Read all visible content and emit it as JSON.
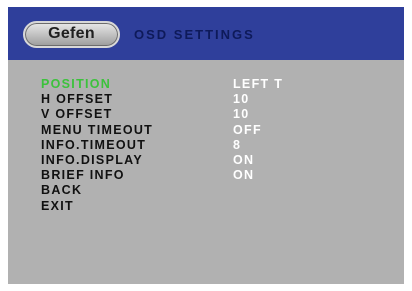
{
  "header": {
    "logo_text": "Gefen",
    "title": "OSD SETTINGS"
  },
  "colors": {
    "header_bg": "#2f3f9b",
    "screen_bg": "#b1b1b1",
    "selected_label": "#3cc23c",
    "value_text": "#ffffff",
    "label_text": "#111111"
  },
  "menu": {
    "selected_index": 0,
    "items": [
      {
        "label": "POSITION",
        "value": "LEFT T"
      },
      {
        "label": "H OFFSET",
        "value": "10"
      },
      {
        "label": "V OFFSET",
        "value": "10"
      },
      {
        "label": "MENU TIMEOUT",
        "value": "OFF"
      },
      {
        "label": "INFO.TIMEOUT",
        "value": "8"
      },
      {
        "label": "INFO.DISPLAY",
        "value": "ON"
      },
      {
        "label": "BRIEF INFO",
        "value": "ON"
      },
      {
        "label": "BACK",
        "value": ""
      },
      {
        "label": "EXIT",
        "value": ""
      }
    ]
  }
}
